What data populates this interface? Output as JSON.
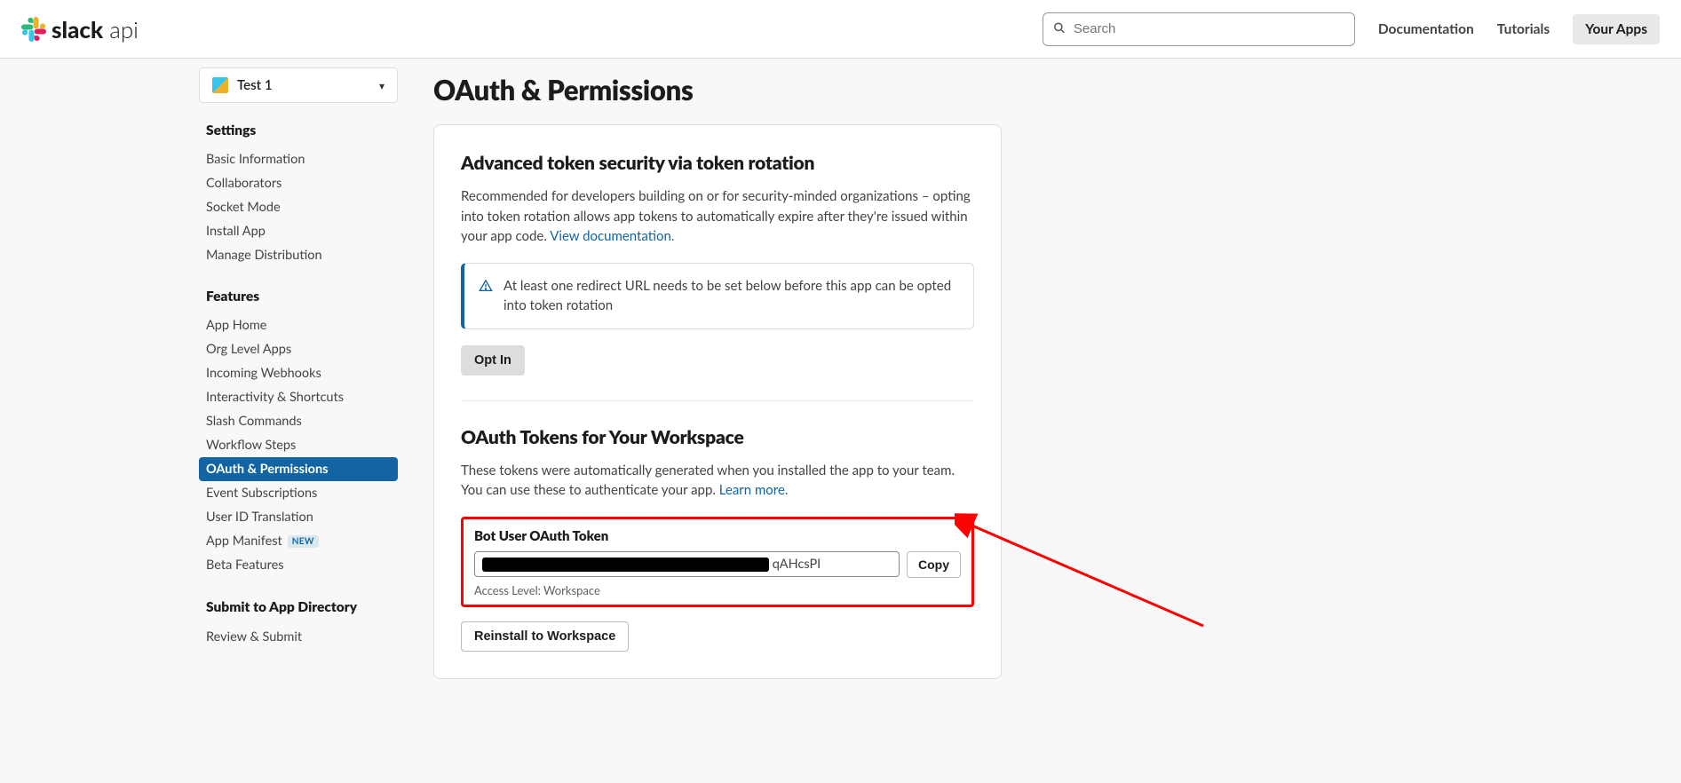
{
  "header": {
    "logo_bold": "slack",
    "logo_thin": " api",
    "search_placeholder": "Search",
    "nav": {
      "documentation": "Documentation",
      "tutorials": "Tutorials",
      "your_apps": "Your Apps"
    }
  },
  "sidebar": {
    "app_name": "Test 1",
    "groups": [
      {
        "heading": "Settings",
        "items": [
          {
            "label": "Basic Information"
          },
          {
            "label": "Collaborators"
          },
          {
            "label": "Socket Mode"
          },
          {
            "label": "Install App"
          },
          {
            "label": "Manage Distribution"
          }
        ]
      },
      {
        "heading": "Features",
        "items": [
          {
            "label": "App Home"
          },
          {
            "label": "Org Level Apps"
          },
          {
            "label": "Incoming Webhooks"
          },
          {
            "label": "Interactivity & Shortcuts"
          },
          {
            "label": "Slash Commands"
          },
          {
            "label": "Workflow Steps"
          },
          {
            "label": "OAuth & Permissions",
            "active": true
          },
          {
            "label": "Event Subscriptions"
          },
          {
            "label": "User ID Translation"
          },
          {
            "label": "App Manifest",
            "badge": "NEW"
          },
          {
            "label": "Beta Features"
          }
        ]
      },
      {
        "heading": "Submit to App Directory",
        "items": [
          {
            "label": "Review & Submit"
          }
        ]
      }
    ]
  },
  "main": {
    "title": "OAuth & Permissions",
    "token_rotation": {
      "title": "Advanced token security via token rotation",
      "text": "Recommended for developers building on or for security-minded organizations – opting into token rotation allows app tokens to automatically expire after they're issued within your app code. ",
      "link": "View documentation.",
      "alert": "At least one redirect URL needs to be set below before this app can be opted into token rotation",
      "opt_in": "Opt In"
    },
    "tokens": {
      "title": "OAuth Tokens for Your Workspace",
      "text": "These tokens were automatically generated when you installed the app to your team. You can use these to authenticate your app. ",
      "link": "Learn more.",
      "bot_label": "Bot User OAuth Token",
      "bot_value_tail": "qAHcsPI",
      "copy": "Copy",
      "access_level": "Access Level: Workspace",
      "reinstall": "Reinstall to Workspace"
    }
  }
}
